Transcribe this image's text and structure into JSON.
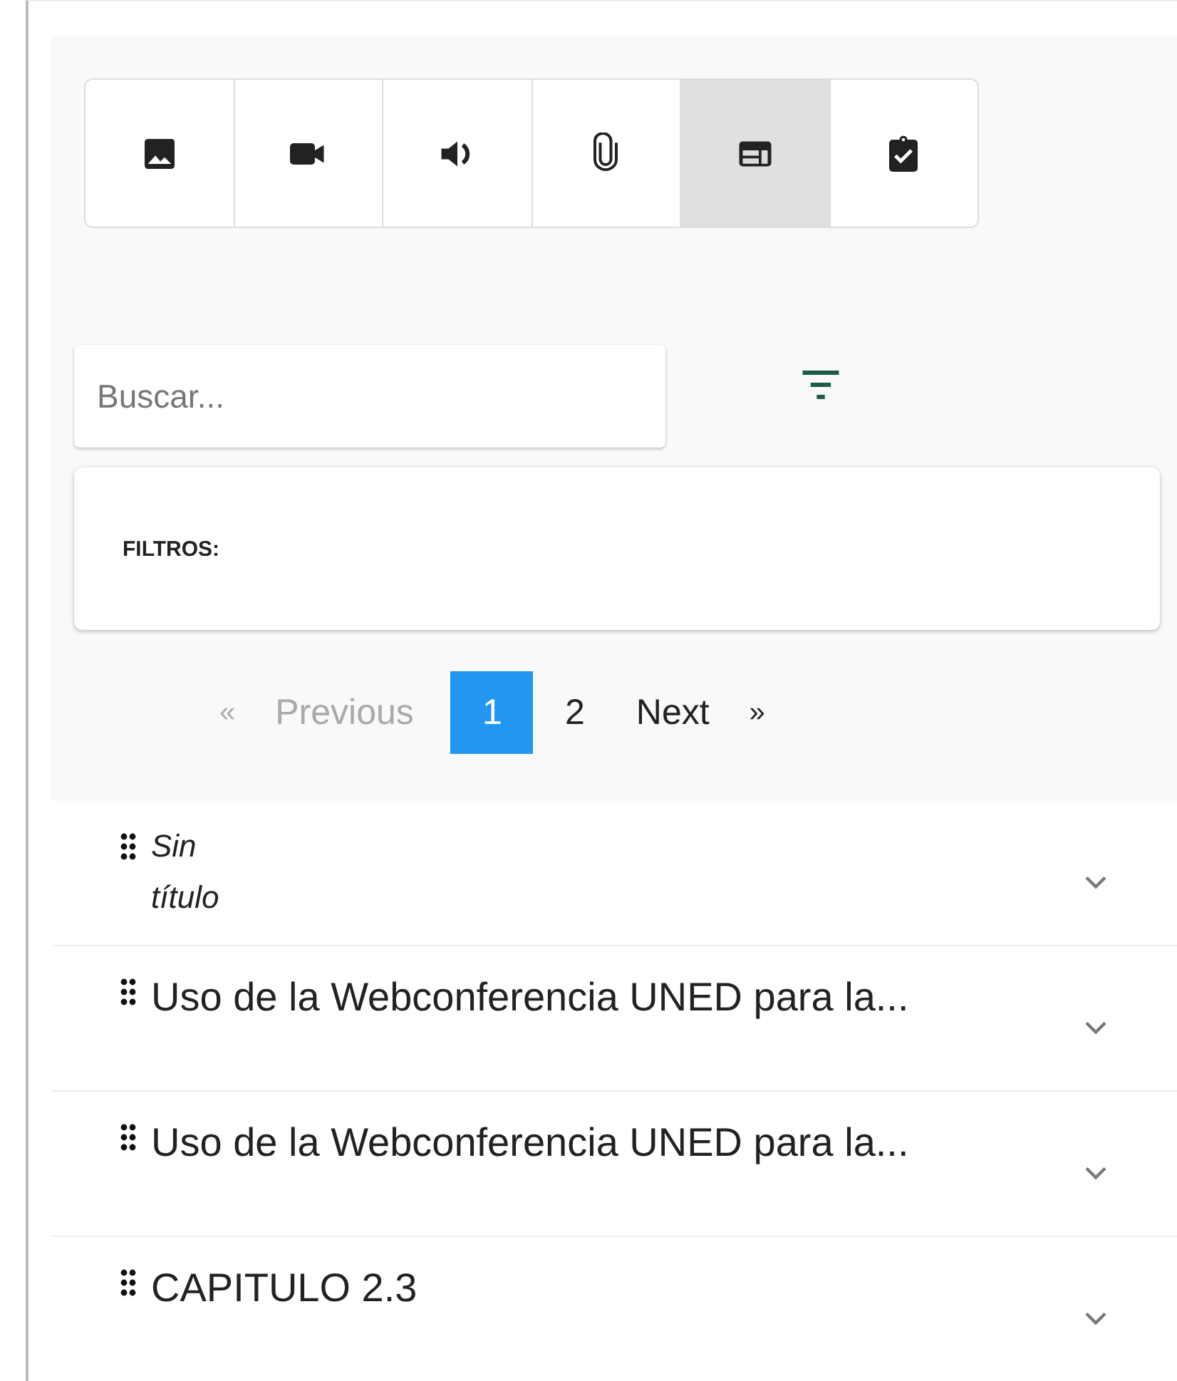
{
  "toolbar": [
    {
      "kind": "image",
      "selected": false
    },
    {
      "kind": "video",
      "selected": false
    },
    {
      "kind": "audio",
      "selected": false
    },
    {
      "kind": "attachment",
      "selected": false
    },
    {
      "kind": "layout",
      "selected": true
    },
    {
      "kind": "task",
      "selected": false
    }
  ],
  "search": {
    "placeholder": "Buscar..."
  },
  "filters": {
    "label": "FILTROS:"
  },
  "pagination": {
    "previous": {
      "arrow": "«",
      "label": "Previous",
      "disabled": true
    },
    "pages": [
      {
        "label": "1",
        "selected": true
      },
      {
        "label": "2",
        "selected": false
      }
    ],
    "next": {
      "arrow": "»",
      "label": "Next",
      "disabled": false
    }
  },
  "items": [
    {
      "kind": "untitled",
      "title": "Sin título"
    },
    {
      "kind": "titled",
      "title": "Uso de la Webconferencia UNED para la..."
    },
    {
      "kind": "titled",
      "title": "Uso de la Webconferencia UNED para la..."
    },
    {
      "kind": "titled",
      "title": "CAPITULO 2.3"
    }
  ]
}
